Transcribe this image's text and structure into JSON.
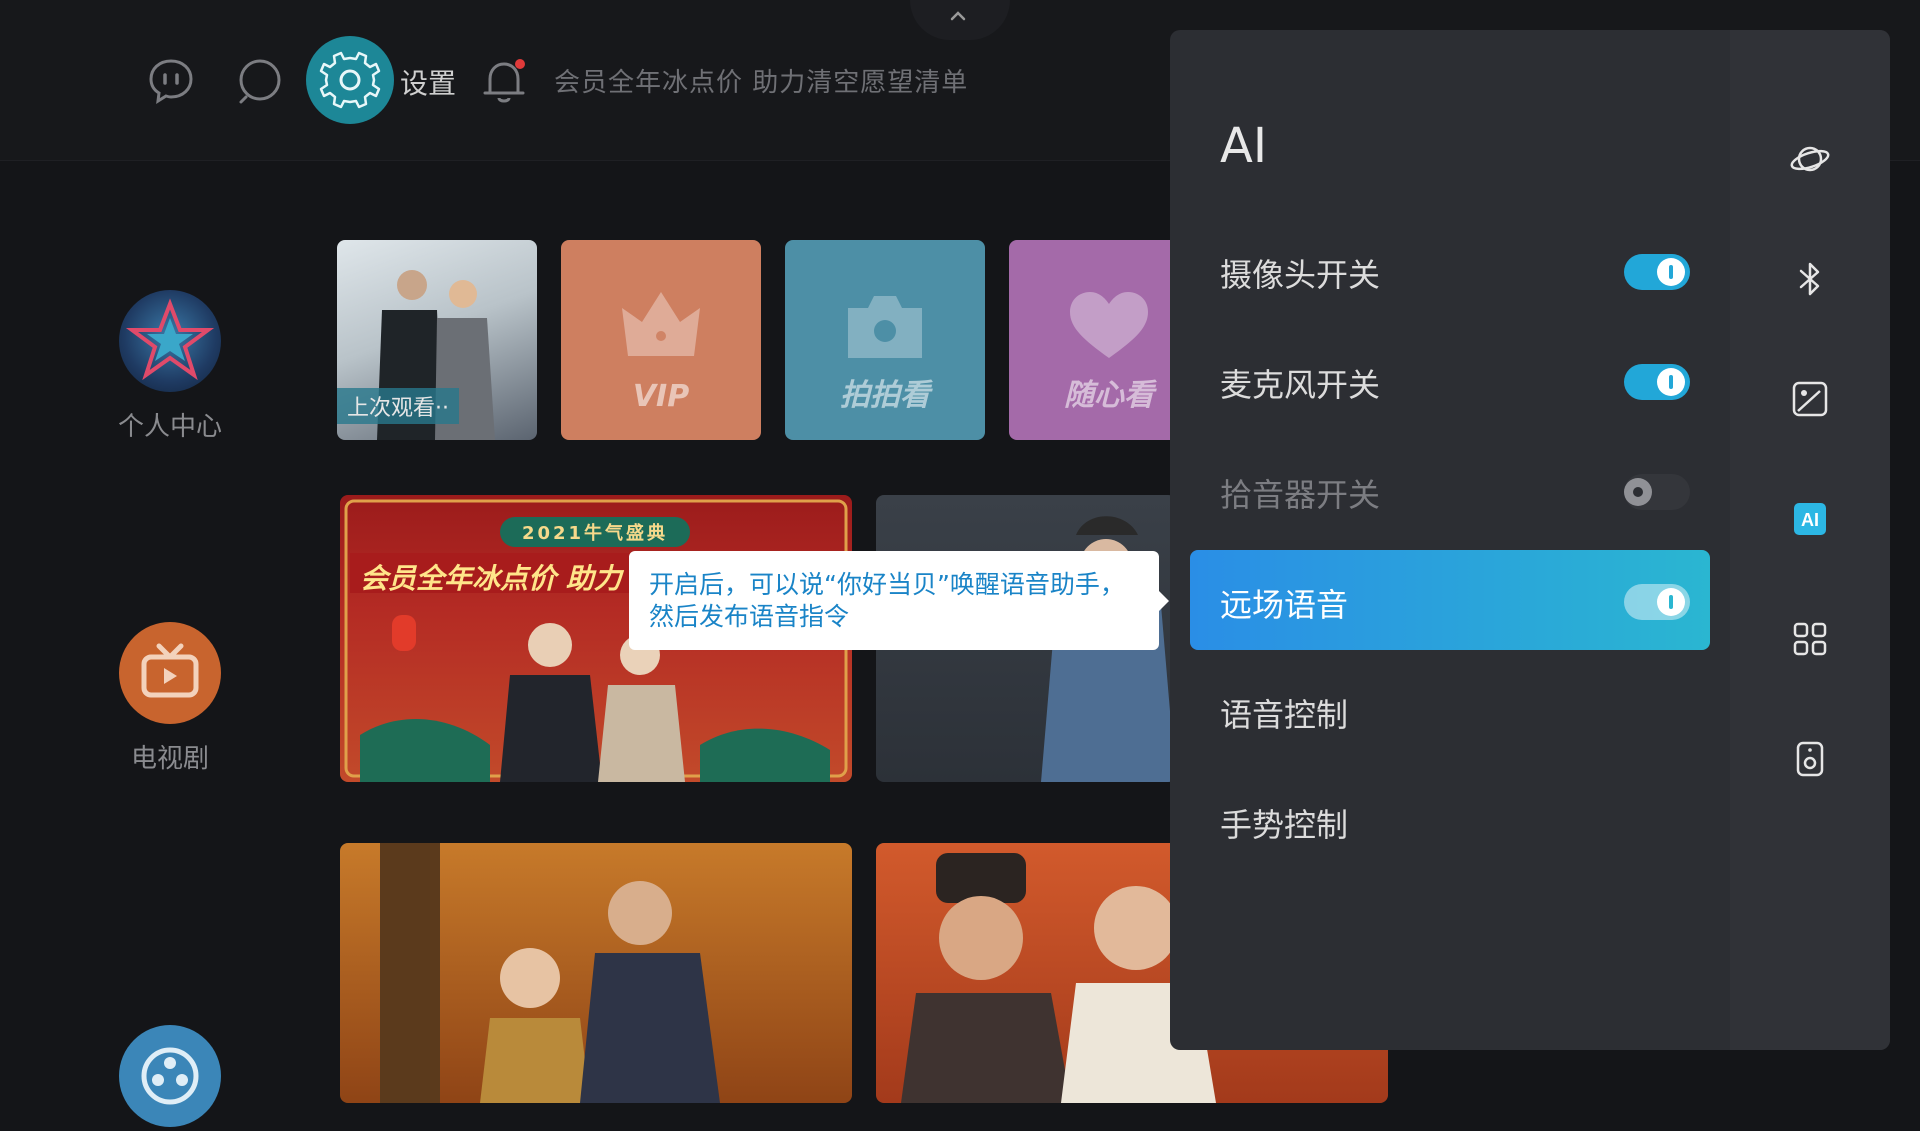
{
  "header": {
    "settings_label": "设置",
    "marquee": "会员全年冰点价 助力清空愿望清单"
  },
  "sidebar": {
    "items": [
      {
        "label": "个人中心"
      },
      {
        "label": "电视剧"
      },
      {
        "label": ""
      }
    ]
  },
  "shortcuts": {
    "recent_label": "上次观看··",
    "cards": [
      {
        "label": "VIP"
      },
      {
        "label": "拍拍看"
      },
      {
        "label": "随心看"
      }
    ]
  },
  "banner": {
    "event": "2021牛气盛典",
    "promo": "会员全年冰点价 助力"
  },
  "tooltip": {
    "text": "开启后，可以说“你好当贝”唤醒语音助手，然后发布语音指令"
  },
  "ai_panel": {
    "title": "AI",
    "items": [
      {
        "label": "摄像头开关",
        "toggle": "on"
      },
      {
        "label": "麦克风开关",
        "toggle": "on"
      },
      {
        "label": "拾音器开关",
        "toggle": "off"
      },
      {
        "label": "远场语音",
        "toggle": "on",
        "active": true
      },
      {
        "label": "语音控制"
      },
      {
        "label": "手势控制"
      }
    ],
    "rail_icons": [
      "planet-icon",
      "bluetooth-icon",
      "picture-icon",
      "ai-icon",
      "apps-grid-icon",
      "speaker-icon"
    ],
    "active_rail": "ai-icon"
  },
  "colors": {
    "accent": "#22a7d8",
    "settings": "#1d8797",
    "active_start": "#2a8ee6",
    "active_end": "#2ab6d1"
  }
}
